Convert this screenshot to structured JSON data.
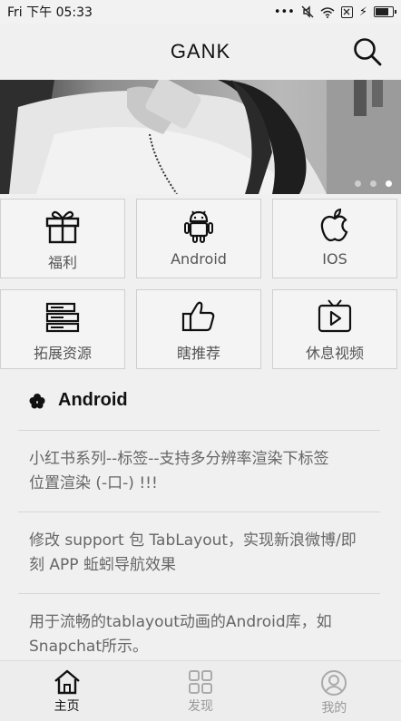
{
  "status_bar": {
    "day": "Fri",
    "ampm": "下午",
    "time": "05:33",
    "dots": "•••",
    "charge": "⚡",
    "battery_level": 0.85
  },
  "app_bar": {
    "title": "GANK",
    "search_icon": "search-icon"
  },
  "banner": {
    "slide_count": 3,
    "active_slide": 3
  },
  "categories": [
    {
      "label": "福利",
      "icon": "gift-icon"
    },
    {
      "label": "Android",
      "icon": "android-icon"
    },
    {
      "label": "IOS",
      "icon": "apple-icon"
    },
    {
      "label": "拓展资源",
      "icon": "server-icon"
    },
    {
      "label": "瞎推荐",
      "icon": "thumbs-up-icon"
    },
    {
      "label": "休息视频",
      "icon": "tv-play-icon"
    }
  ],
  "section": {
    "title": "Android",
    "icon": "flower-icon"
  },
  "articles": [
    {
      "line1": "小红书系列--标签--支持多分辨率渲染下标签",
      "line2": "位置渲染 (-口-) !!!"
    },
    {
      "line1": "修改 support 包 TabLayout，实现新浪微博/即",
      "line2": "刻 APP 蚯蚓导航效果"
    },
    {
      "line1": "用于流畅的tablayout动画的Android库，如",
      "line2": "Snapchat所示。"
    }
  ],
  "bottom_nav": [
    {
      "label": "主页",
      "icon": "home-icon",
      "active": true
    },
    {
      "label": "发现",
      "icon": "grid-icon",
      "active": false
    },
    {
      "label": "我的",
      "icon": "user-icon",
      "active": false
    }
  ],
  "colors": {
    "background": "#f0f0f0",
    "tile_border": "#cfcfcf",
    "text_muted": "#666666",
    "nav_inactive": "#999999"
  }
}
